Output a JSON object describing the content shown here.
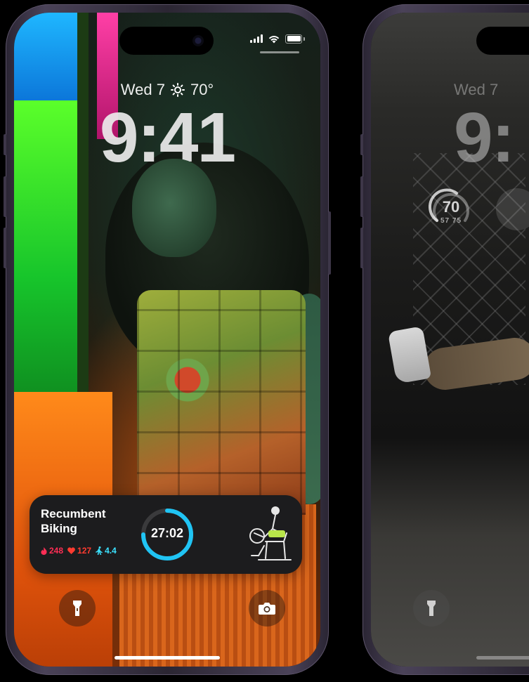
{
  "left_phone": {
    "status": {
      "signal_icon": "cellular-signal-icon",
      "wifi_icon": "wifi-icon",
      "battery_icon": "battery-icon"
    },
    "date": "Wed 7",
    "weather_icon": "sun-icon",
    "temperature": "70°",
    "time": "9:41",
    "live_activity": {
      "title_line1": "Recumbent",
      "title_line2": "Biking",
      "calories": "248",
      "heart_rate": "127",
      "distance": "4.4",
      "timer": "27:02",
      "ring_color": "#20c4f4",
      "calories_color": "#ff2e55",
      "heart_color": "#ff3b30",
      "distance_color": "#3be2ff"
    },
    "flashlight_icon": "flashlight-icon",
    "camera_icon": "camera-icon"
  },
  "right_phone": {
    "date": "Wed 7",
    "time": "9:",
    "gauge": {
      "value": "70",
      "range": "57 75"
    },
    "flashlight_icon": "flashlight-icon"
  }
}
